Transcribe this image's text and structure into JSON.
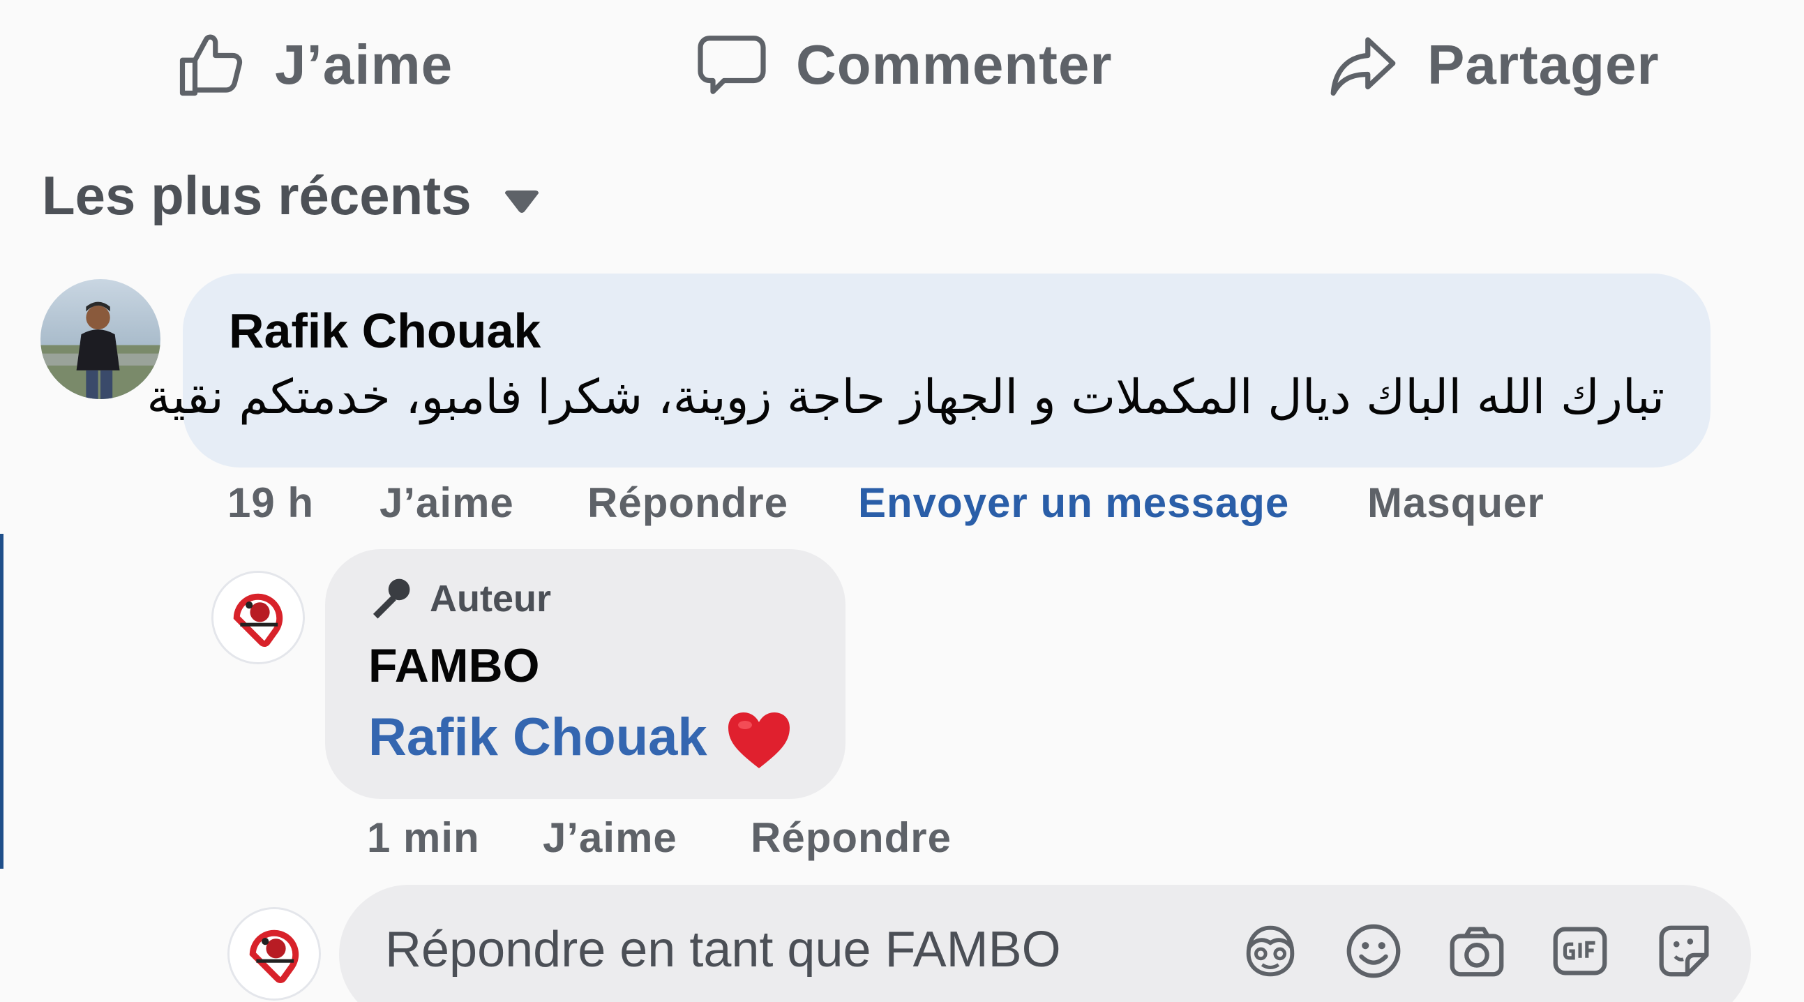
{
  "actions": {
    "like": "J’aime",
    "comment": "Commenter",
    "share": "Partager"
  },
  "sort": {
    "label": "Les plus récents"
  },
  "comment": {
    "author": "Rafik Chouak",
    "text": "تبارك الله الباك ديال المكملات و الجهاز حاجة زوينة، شكرا فامبو، خدمتكم نقية",
    "time": "19 h",
    "like": "J’aime",
    "reply": "Répondre",
    "message": "Envoyer un message",
    "hide": "Masquer"
  },
  "reply": {
    "badge": "Auteur",
    "author": "FAMBO",
    "mention": "Rafik Chouak",
    "time": "1 min",
    "like": "J’aime",
    "reply": "Répondre"
  },
  "composer": {
    "placeholder": "Répondre en tant que FAMBO"
  },
  "icons": {
    "like": "thumbs-up-icon",
    "comment": "speech-bubble-icon",
    "share": "share-arrow-icon",
    "sort": "caret-down-icon",
    "badge": "microphone-icon",
    "heart": "red-heart-emoji",
    "avatar_sticker": "avatar-sticker-icon",
    "emoji": "smiley-icon",
    "camera": "camera-icon",
    "gif": "gif-icon",
    "sticker": "sticker-icon"
  },
  "colors": {
    "link_blue": "#2a5ea8",
    "bubble": "#e6edf6",
    "heart": "#e0202e"
  }
}
